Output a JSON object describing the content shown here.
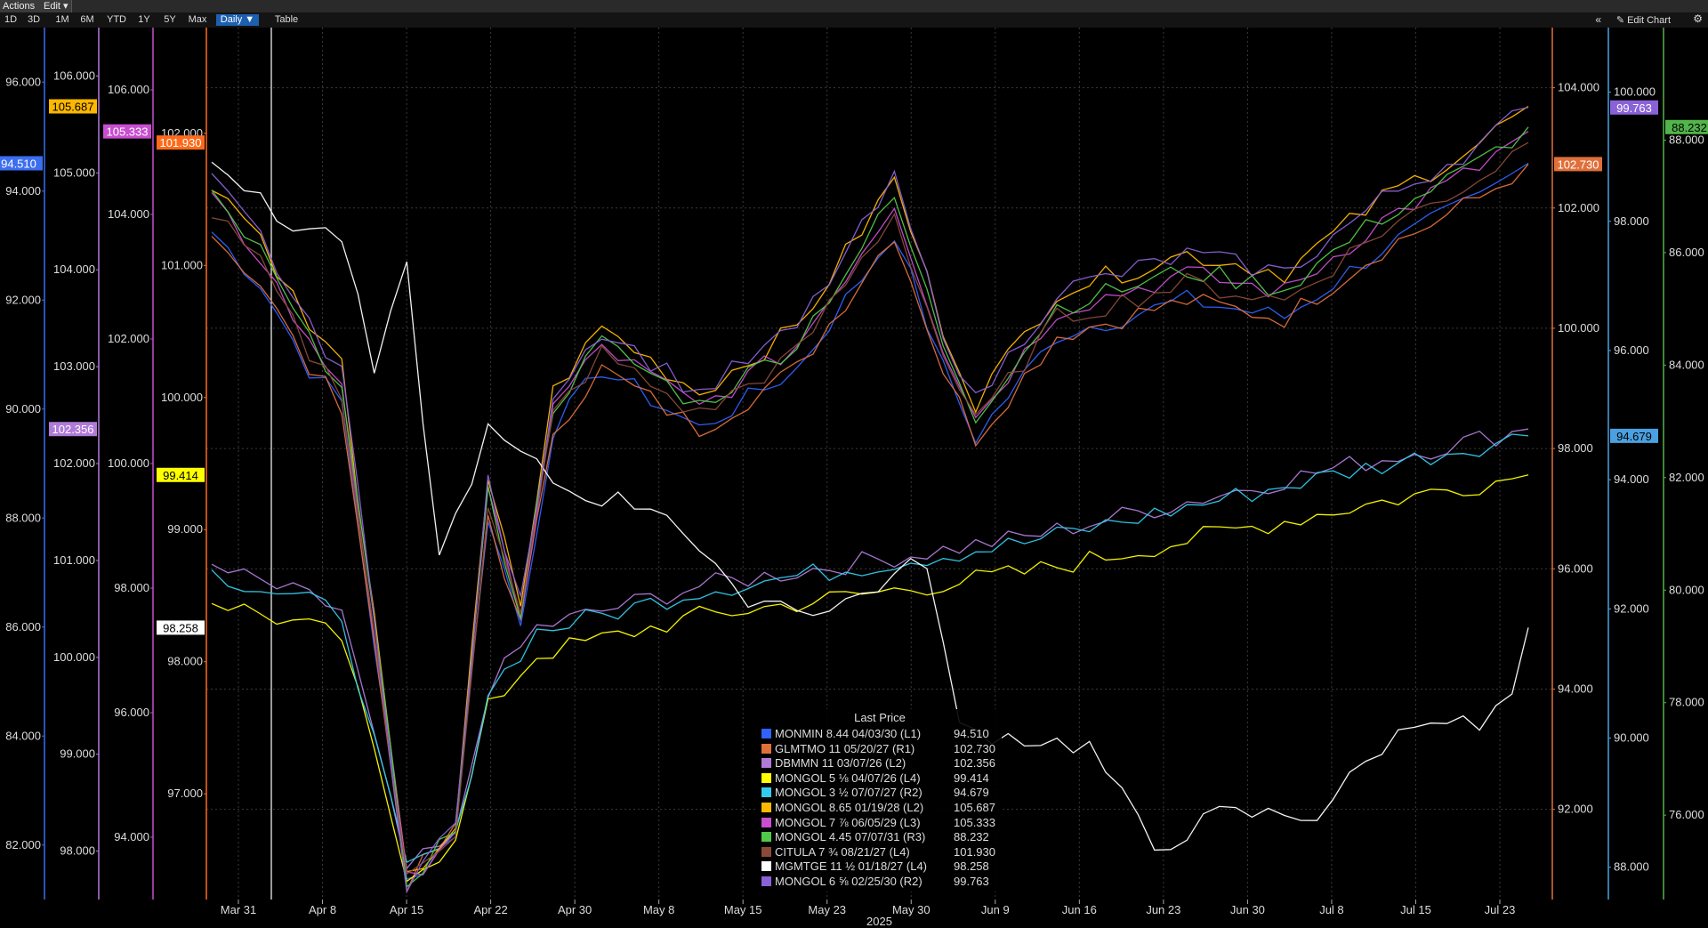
{
  "toolbar": {
    "actions_label": "Actions ▾",
    "edit_label": "Edit ▾"
  },
  "ranges": [
    "1D",
    "3D",
    "1M",
    "6M",
    "YTD",
    "1Y",
    "5Y",
    "Max"
  ],
  "frequency_label": "Daily ▼",
  "table_label": "Table",
  "collapse_glyph": "«",
  "edit_chart_label": "✎ Edit Chart",
  "gear_glyph": "⚙",
  "legend_title": "Last Price",
  "year_label": "2025",
  "chart_data": {
    "type": "line",
    "title": "",
    "x_ticks": [
      "Mar 31",
      "Apr 8",
      "Apr 15",
      "Apr 22",
      "Apr 30",
      "May 8",
      "May 15",
      "May 23",
      "May 30",
      "Jun 9",
      "Jun 16",
      "Jun 23",
      "Jun 30",
      "Jul 8",
      "Jul 15",
      "Jul 23"
    ],
    "axes": {
      "L1": {
        "color": "#3c6ef0",
        "range": [
          81.0,
          97.0
        ],
        "ticks": [
          "96.000",
          "94.000",
          "92.000",
          "90.000",
          "88.000",
          "86.000",
          "84.000",
          "82.000"
        ],
        "last": "94.510"
      },
      "L2": {
        "color": "#b07bd8",
        "range": [
          97.5,
          106.5
        ],
        "ticks": [
          "106.000",
          "105.000",
          "104.000",
          "103.000",
          "102.000",
          "101.000",
          "100.000",
          "99.000",
          "98.000"
        ],
        "last": "102.356"
      },
      "L3": {
        "color": "#c84fd0",
        "range": [
          93.0,
          107.0
        ],
        "ticks": [
          "106.000",
          "104.000",
          "102.000",
          "100.000",
          "98.000",
          "96.000",
          "94.000"
        ],
        "last": "105.333"
      },
      "L4": {
        "color": "#ff6a1a",
        "range": [
          96.2,
          102.8
        ],
        "ticks": [
          "102.000",
          "101.000",
          "100.000",
          "99.000",
          "98.000",
          "97.000"
        ],
        "last": "101.930"
      },
      "R1": {
        "color": "#e0703a",
        "range": [
          90.5,
          105.0
        ],
        "ticks": [
          "104.000",
          "102.000",
          "100.000",
          "98.000",
          "96.000",
          "94.000",
          "92.000"
        ],
        "last": "102.730"
      },
      "R2": {
        "color": "#4aa0e0",
        "range": [
          87.5,
          101.0
        ],
        "ticks": [
          "100.000",
          "98.000",
          "96.000",
          "94.000",
          "92.000",
          "90.000",
          "88.000"
        ],
        "last": "94.679"
      },
      "R3": {
        "color": "#52b44a",
        "range": [
          74.5,
          90.0
        ],
        "ticks": [
          "88.000",
          "86.000",
          "84.000",
          "82.000",
          "80.000",
          "78.000",
          "76.000"
        ],
        "last": "88.232"
      }
    },
    "extra_tags": [
      {
        "axis": "L2",
        "value": "105.687",
        "color": "#ffb800"
      },
      {
        "axis": "L4",
        "value": "99.414",
        "color": "#ffff00"
      },
      {
        "axis": "L4",
        "value": "98.258",
        "color": "#ffffff"
      },
      {
        "axis": "R2",
        "value": "99.763",
        "color": "#8a62d8"
      }
    ],
    "series": [
      {
        "name": "MONMIN 8.44 04/03/30",
        "axis": "L1",
        "color": "#2f62ff",
        "last": "94.510"
      },
      {
        "name": "GLMTMO 11 05/20/27",
        "axis": "R1",
        "color": "#e0703a",
        "last": "102.730"
      },
      {
        "name": "DBMMN 11 03/07/26",
        "axis": "L2",
        "color": "#b07bd8",
        "last": "102.356"
      },
      {
        "name": "MONGOL 5 ⅛ 04/07/26",
        "axis": "L4",
        "color": "#ffff00",
        "last": "99.414"
      },
      {
        "name": "MONGOL 3 ½ 07/07/27",
        "axis": "R2",
        "color": "#33ccee",
        "last": "94.679"
      },
      {
        "name": "MONGOL 8.65 01/19/28",
        "axis": "L2",
        "color": "#ffb800",
        "last": "105.687"
      },
      {
        "name": "MONGOL 7 ⅞ 06/05/29",
        "axis": "L3",
        "color": "#c84fd0",
        "last": "105.333"
      },
      {
        "name": "MONGOL 4.45 07/07/31",
        "axis": "R3",
        "color": "#52c84a",
        "last": "88.232"
      },
      {
        "name": "CITULA 7 ¾ 08/21/27",
        "axis": "L4",
        "color": "#8a4a3a",
        "last": "101.930"
      },
      {
        "name": "MGMTGE 11 ½ 01/18/27",
        "axis": "L4",
        "color": "#ffffff",
        "last": "98.258"
      },
      {
        "name": "MONGOL 6 ⅝ 02/25/30",
        "axis": "R2",
        "color": "#8a62d8",
        "last": "99.763"
      }
    ],
    "legend_axis_labels": [
      "(L1)",
      "(R1)",
      "(L2)",
      "(L4)",
      "(R2)",
      "(L2)",
      "(L3)",
      "(R3)",
      "(L4)",
      "(L4)",
      "(R2)"
    ]
  }
}
